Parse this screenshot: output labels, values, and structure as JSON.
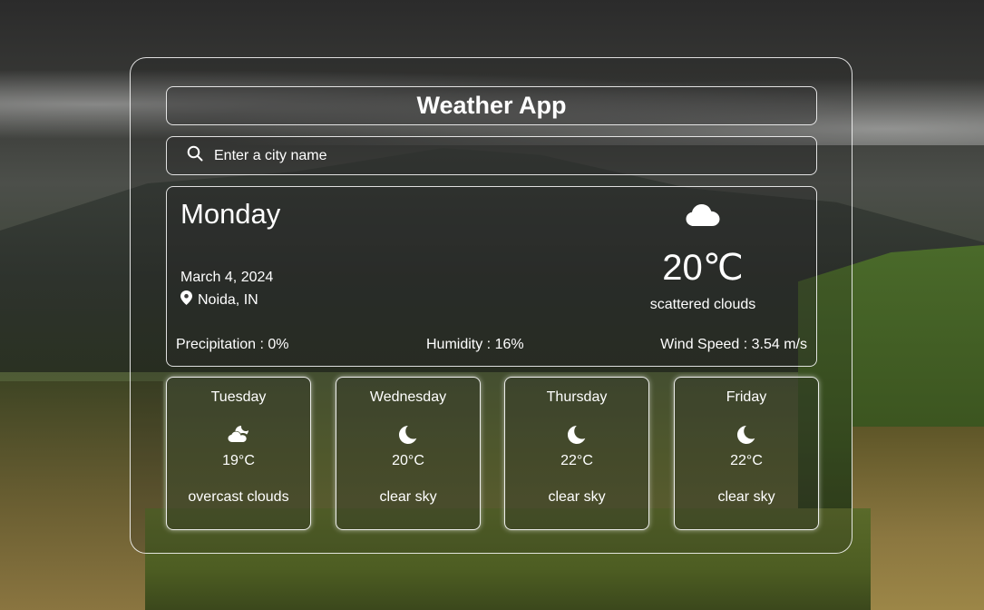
{
  "app": {
    "title": "Weather App"
  },
  "search": {
    "placeholder": "Enter a city name",
    "value": "",
    "icon": "search-icon"
  },
  "current": {
    "day": "Monday",
    "date": "March 4, 2024",
    "location": "Noida, IN",
    "location_icon": "map-pin-icon",
    "condition_icon": "cloud-icon",
    "temperature": "20℃",
    "description": "scattered clouds",
    "precipitation": "Precipitation : 0%",
    "humidity": "Humidity : 16%",
    "wind": "Wind Speed : 3.54 m/s"
  },
  "forecast": [
    {
      "day": "Tuesday",
      "icon": "cloud-moon-icon",
      "temp": "19°C",
      "desc": "overcast clouds"
    },
    {
      "day": "Wednesday",
      "icon": "moon-icon",
      "temp": "20°C",
      "desc": "clear sky"
    },
    {
      "day": "Thursday",
      "icon": "moon-icon",
      "temp": "22°C",
      "desc": "clear sky"
    },
    {
      "day": "Friday",
      "icon": "moon-icon",
      "temp": "22°C",
      "desc": "clear sky"
    }
  ]
}
